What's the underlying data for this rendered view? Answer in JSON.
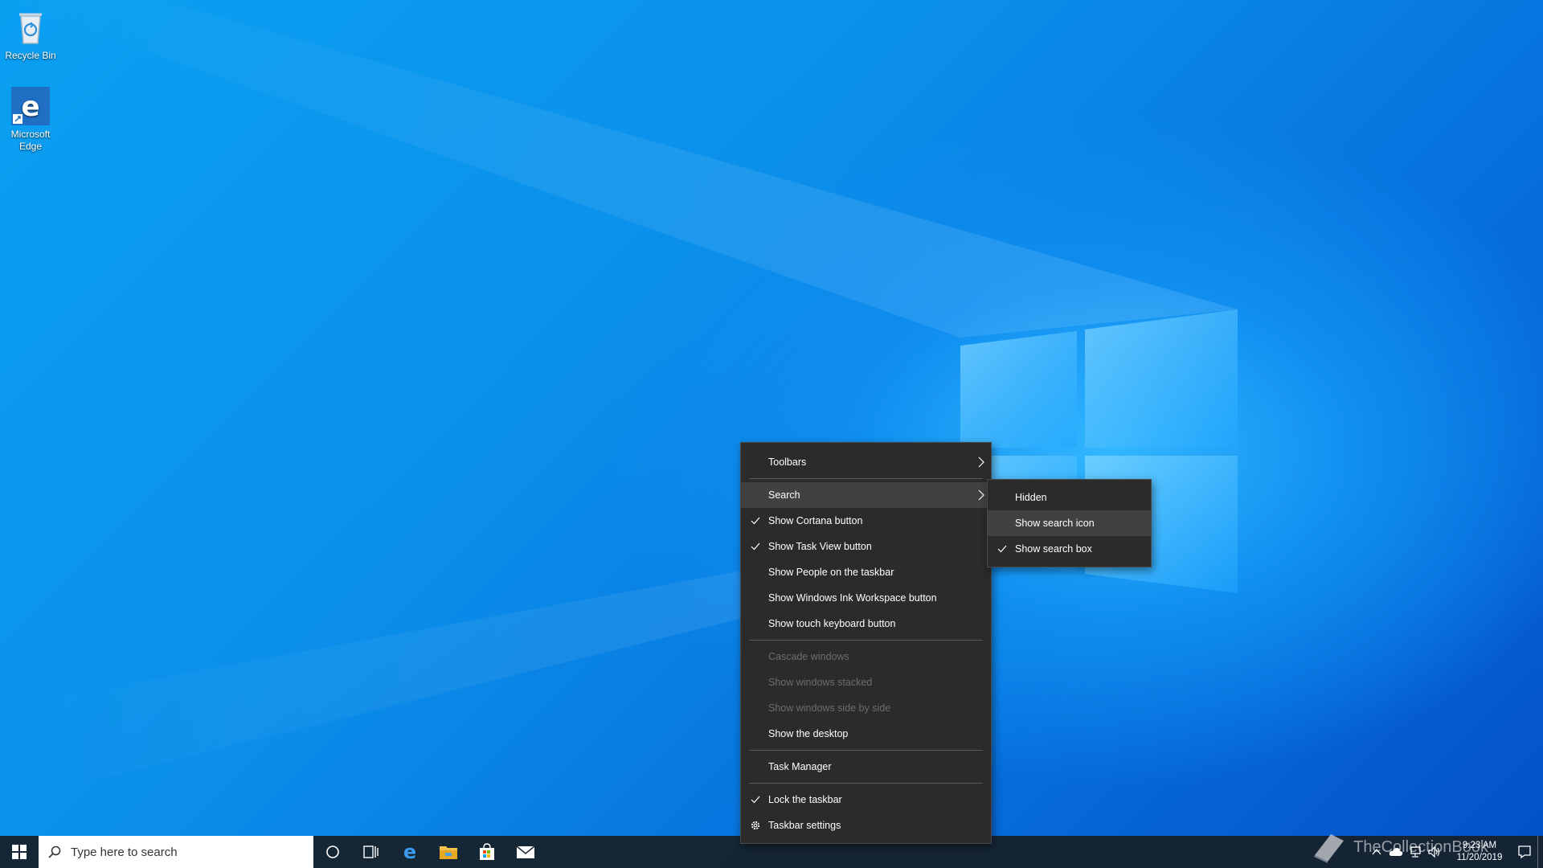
{
  "desktop": {
    "icons": [
      {
        "label": "Recycle Bin",
        "icon": "recycle-bin-icon"
      },
      {
        "label": "Microsoft Edge",
        "icon": "edge-icon"
      }
    ]
  },
  "taskbar": {
    "search_placeholder": "Type here to search",
    "pinned": [
      "start-icon",
      "search-icon",
      "cortana-icon",
      "task-view-icon",
      "edge-icon",
      "file-explorer-icon",
      "store-icon",
      "mail-icon"
    ],
    "clock_time": "9:23 AM",
    "clock_date": "11/20/2019"
  },
  "watermark": "TheCollectionBook",
  "context_menu": {
    "items": [
      {
        "label": "Toolbars",
        "submenu": true
      },
      {
        "label": "Search",
        "submenu": true,
        "highlighted": true
      },
      {
        "label": "Show Cortana button",
        "checked": true
      },
      {
        "label": "Show Task View button",
        "checked": true
      },
      {
        "label": "Show People on the taskbar"
      },
      {
        "label": "Show Windows Ink Workspace button"
      },
      {
        "label": "Show touch keyboard button"
      },
      {
        "label": "Cascade windows",
        "disabled": true
      },
      {
        "label": "Show windows stacked",
        "disabled": true
      },
      {
        "label": "Show windows side by side",
        "disabled": true
      },
      {
        "label": "Show the desktop"
      },
      {
        "label": "Task Manager"
      },
      {
        "label": "Lock the taskbar",
        "checked": true
      },
      {
        "label": "Taskbar settings",
        "icon": "gear-icon"
      }
    ]
  },
  "search_submenu": {
    "items": [
      {
        "label": "Hidden"
      },
      {
        "label": "Show search icon",
        "highlighted": true
      },
      {
        "label": "Show search box",
        "checked": true
      }
    ]
  },
  "colors": {
    "menu_bg": "#2b2b2b",
    "menu_highlight": "#414141",
    "taskbar_bg": "#16222e",
    "desktop_accent": "#0a8de8"
  }
}
